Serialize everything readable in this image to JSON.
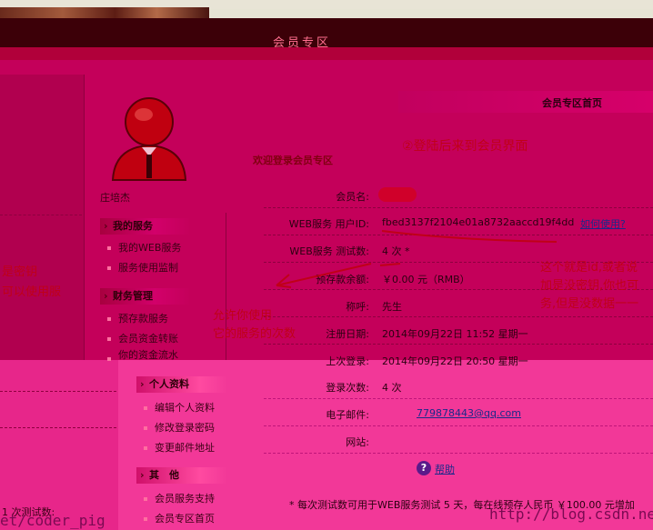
{
  "header": {
    "title": "会员专区"
  },
  "sidebar": {
    "user_name": "庄培杰",
    "sections": [
      {
        "title": "我的服务",
        "items": [
          "我的WEB服务",
          "服务使用监制"
        ]
      },
      {
        "title": "财务管理",
        "items": [
          "预存款服务",
          "会员资金转账",
          "你的资金流水"
        ]
      },
      {
        "title": "个人资料",
        "items": [
          "编辑个人资料",
          "修改登录密码",
          "变更邮件地址"
        ]
      },
      {
        "title": "其　他",
        "items": [
          "会员服务支持",
          "会员专区首页"
        ]
      }
    ]
  },
  "main": {
    "title": "会员专区首页",
    "welcome": "欢迎登录会员专区",
    "rows": [
      {
        "label": "会员名:",
        "value": ""
      },
      {
        "label": "WEB服务 用户ID:",
        "value": "fbed3137f2104e01a8732aaccd19f4dd",
        "link": "如何使用?"
      },
      {
        "label": "WEB服务 测试数:",
        "value": "4 次 *"
      },
      {
        "label": "预存款余额:",
        "value": "￥0.00 元（RMB）"
      },
      {
        "label": "称呼:",
        "value": "先生"
      },
      {
        "label": "注册日期:",
        "value": "2014年09月22日 11:52 星期一"
      },
      {
        "label": "上次登录:",
        "value": "2014年09月22日 20:50 星期一"
      },
      {
        "label": "登录次数:",
        "value": "4 次"
      },
      {
        "label": "电子邮件:",
        "value": "779878443@qq.com"
      },
      {
        "label": "网站:",
        "value": ""
      }
    ],
    "help": "帮助",
    "footnote": "* 每次测试数可用于WEB服务测试 5 天，每在线预存人民币 ￥100.00 元增加"
  },
  "annotations": {
    "step": "②登陆后来到会员界面",
    "id_note_1": "这个就是id,或者说",
    "id_note_2": "加是没密钥,你也可",
    "id_note_3": "务,但是没数据一一",
    "count_note_1": "允许你使用",
    "count_note_2": "它的服务的次数",
    "left_note_1": "是密钥",
    "left_note_2": "可以使用服",
    "left_note_3": "1 次测试数:"
  },
  "watermarks": {
    "left": "et/coder_pig",
    "right": "http://blog.csdn.ne"
  }
}
